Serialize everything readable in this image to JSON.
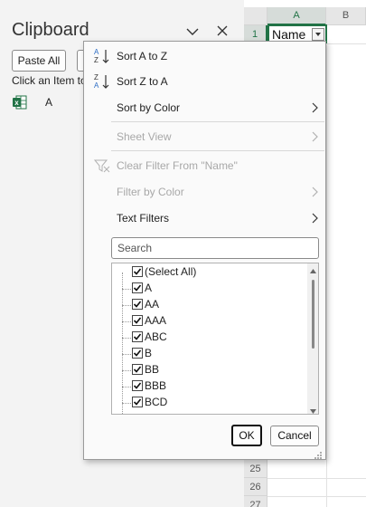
{
  "clipboard": {
    "title": "Clipboard",
    "paste_all_label": "Paste All",
    "hint": "Click an Item to paste:",
    "items": [
      {
        "label": "A",
        "icon": "excel-icon"
      }
    ]
  },
  "grid": {
    "columns": [
      "A",
      "B"
    ],
    "rows": [
      "1",
      "25",
      "26",
      "27"
    ],
    "cell_a1": "Name"
  },
  "menu": {
    "sort_asc": "Sort A to Z",
    "sort_desc": "Sort Z to A",
    "sort_by_color": "Sort by Color",
    "sheet_view": "Sheet View",
    "clear_filter": "Clear Filter From \"Name\"",
    "filter_by_color": "Filter by Color",
    "text_filters": "Text Filters",
    "search_placeholder": "Search",
    "list_items": [
      "(Select All)",
      "A",
      "AA",
      "AAA",
      "ABC",
      "B",
      "BB",
      "BBB",
      "BCD"
    ],
    "ok_label": "OK",
    "cancel_label": "Cancel"
  },
  "colors": {
    "excel_green": "#217346",
    "disabled_text": "#a8a8a8",
    "sort_icon_blue": "#2b6cc4"
  }
}
